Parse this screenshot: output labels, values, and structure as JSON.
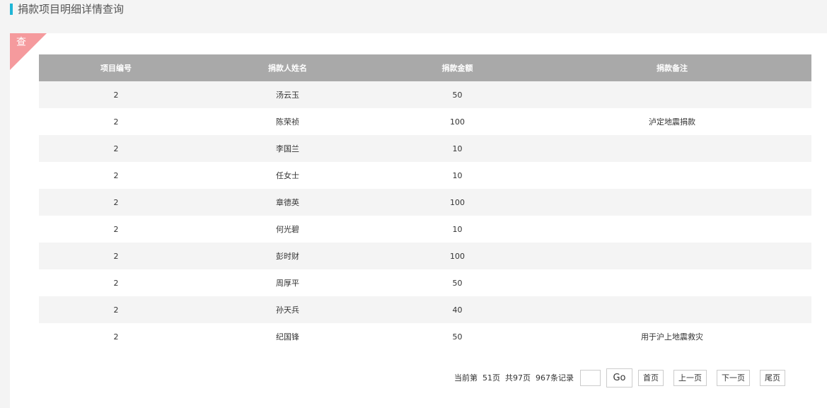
{
  "header": {
    "title": "捐款项目明细详情查询"
  },
  "panel": {
    "corner_label": "查"
  },
  "table": {
    "columns": [
      "项目编号",
      "捐款人姓名",
      "捐款金额",
      "捐款备注"
    ],
    "rows": [
      [
        "2",
        "汤云玉",
        "50",
        ""
      ],
      [
        "2",
        "陈荣祯",
        "100",
        "泸定地震捐款"
      ],
      [
        "2",
        "李国兰",
        "10",
        ""
      ],
      [
        "2",
        "任女士",
        "10",
        ""
      ],
      [
        "2",
        "章德英",
        "100",
        ""
      ],
      [
        "2",
        "何光碧",
        "10",
        ""
      ],
      [
        "2",
        "彭时财",
        "100",
        ""
      ],
      [
        "2",
        "周厚平",
        "50",
        ""
      ],
      [
        "2",
        "孙天兵",
        "40",
        ""
      ],
      [
        "2",
        "纪国锋",
        "50",
        "用于沪上地震救灾"
      ]
    ]
  },
  "pager": {
    "current": "当前第  51页",
    "total_pages": "共97页",
    "total_records": "967条记录",
    "input_value": "",
    "go": "Go",
    "first": "首页",
    "prev": "上一页",
    "next": "下一页",
    "last": "尾页"
  }
}
